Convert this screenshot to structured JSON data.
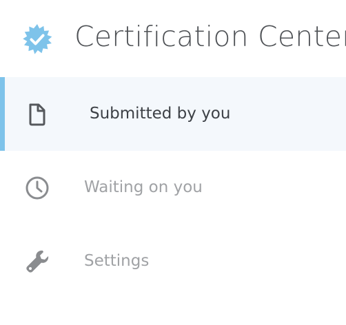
{
  "header": {
    "title": "Certification Center",
    "logo_icon": "verified-badge-icon",
    "logo_color": "#7ec3ea"
  },
  "nav": {
    "items": [
      {
        "label": "Submitted by you",
        "icon": "document-icon",
        "active": true
      },
      {
        "label": "Waiting on you",
        "icon": "clock-icon",
        "active": false
      },
      {
        "label": "Settings",
        "icon": "wrench-icon",
        "active": false
      }
    ]
  },
  "colors": {
    "accent": "#7ec3ea",
    "active_background": "#f4f8fc",
    "active_text": "#3d4146",
    "muted_text": "#a0a2a5",
    "icon_active": "#55585c",
    "icon_muted": "#8a8c8f"
  }
}
